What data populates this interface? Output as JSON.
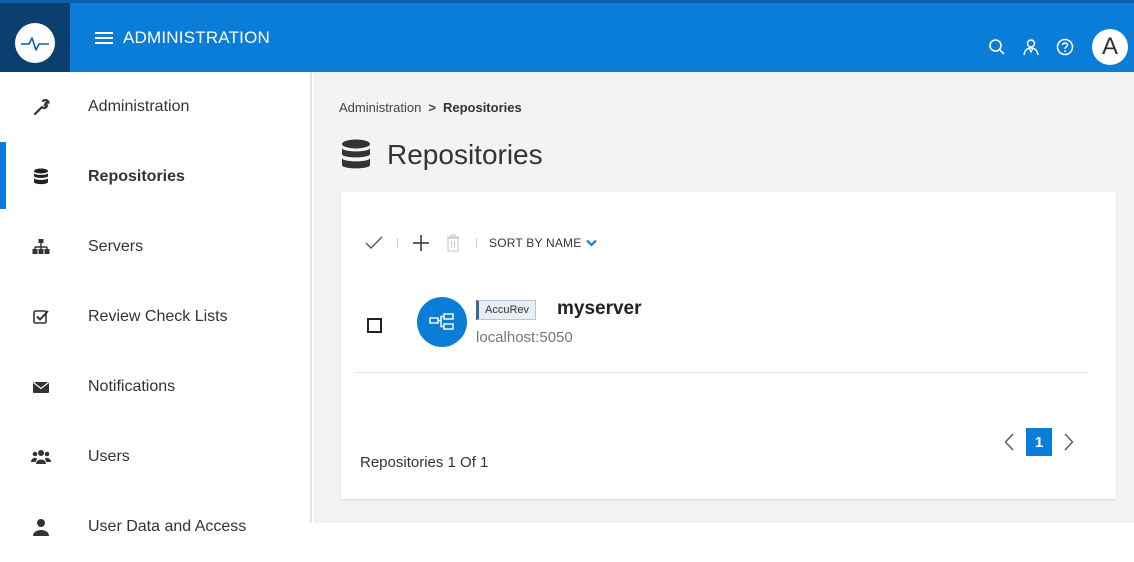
{
  "header": {
    "menu_label": "ADMINISTRATION",
    "avatar_letter": "A",
    "accent_color": "#0a7dd8"
  },
  "sidebar": {
    "items": [
      {
        "label": "Administration",
        "icon": "wrench-icon"
      },
      {
        "label": "Repositories",
        "icon": "database-icon",
        "active": true
      },
      {
        "label": "Servers",
        "icon": "sitemap-icon"
      },
      {
        "label": "Review Check Lists",
        "icon": "checkbox-icon"
      },
      {
        "label": "Notifications",
        "icon": "envelope-icon"
      },
      {
        "label": "Users",
        "icon": "users-icon"
      },
      {
        "label": "User Data and Access",
        "icon": "user-icon"
      }
    ]
  },
  "breadcrumb": {
    "parent": "Administration",
    "separator": ">",
    "current": "Repositories"
  },
  "page": {
    "title": "Repositories"
  },
  "toolbar": {
    "sort_label": "SORT BY NAME"
  },
  "repositories": [
    {
      "type_badge": "AccuRev",
      "name": "myserver",
      "host": "localhost:5050"
    }
  ],
  "footer": {
    "count_label": "Repositories 1 Of 1",
    "current_page": "1"
  }
}
